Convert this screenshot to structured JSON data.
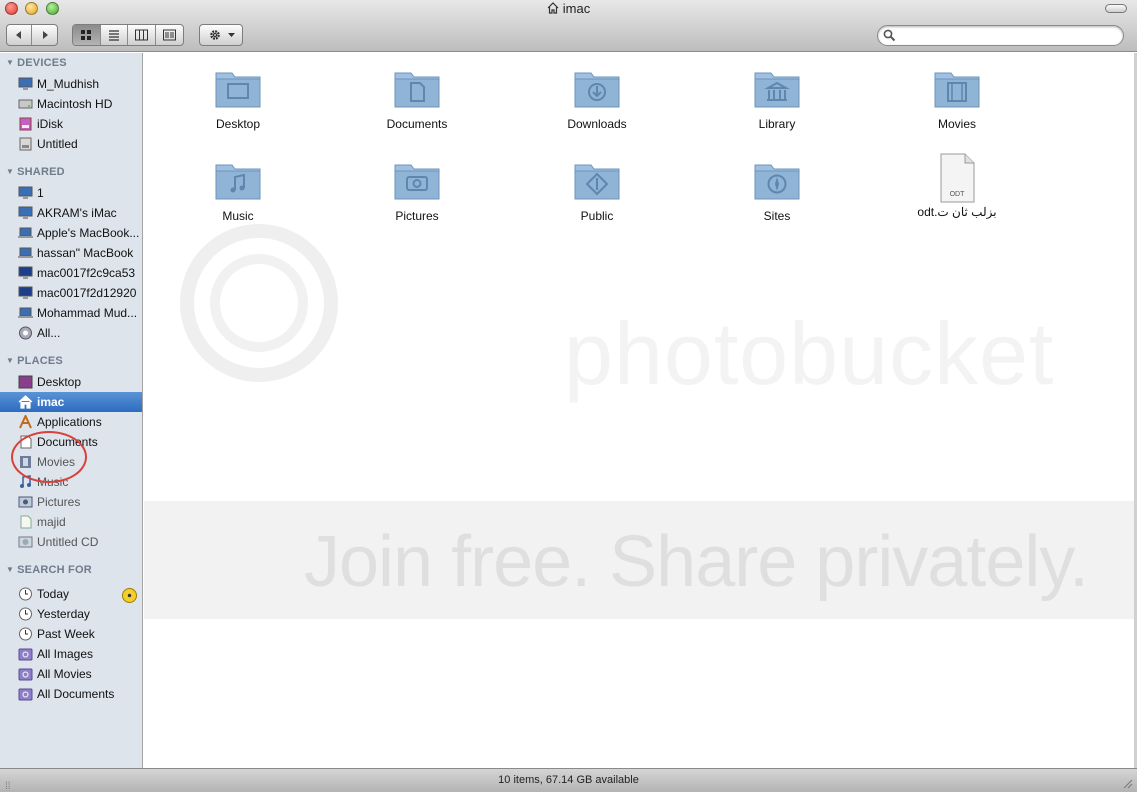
{
  "window": {
    "title": "imac"
  },
  "toolbar": {
    "back_icon": "back-arrow-icon",
    "forward_icon": "forward-arrow-icon",
    "views": [
      "icon-view",
      "list-view",
      "column-view",
      "coverflow-view"
    ],
    "search_placeholder": ""
  },
  "sidebar": {
    "devices": {
      "title": "DEVICES",
      "items": [
        {
          "label": "M_Mudhish",
          "icon": "computer-icon"
        },
        {
          "label": "Macintosh HD",
          "icon": "harddisk-icon"
        },
        {
          "label": "iDisk",
          "icon": "idisk-icon"
        },
        {
          "label": "Untitled",
          "icon": "disk-icon"
        }
      ]
    },
    "shared": {
      "title": "SHARED",
      "items": [
        {
          "label": "1",
          "icon": "computer-icon"
        },
        {
          "label": "AKRAM's iMac",
          "icon": "computer-icon"
        },
        {
          "label": "Apple's MacBook...",
          "icon": "laptop-icon"
        },
        {
          "label": "hassan\" MacBook",
          "icon": "laptop-icon"
        },
        {
          "label": "mac0017f2c9ca53",
          "icon": "computer-icon"
        },
        {
          "label": "mac0017f2d12920",
          "icon": "computer-icon"
        },
        {
          "label": "Mohammad Mud...",
          "icon": "laptop-icon"
        },
        {
          "label": "All...",
          "icon": "network-icon"
        }
      ]
    },
    "places": {
      "title": "PLACES",
      "items": [
        {
          "label": "Desktop",
          "icon": "desktop-icon"
        },
        {
          "label": "imac",
          "icon": "home-icon"
        },
        {
          "label": "Applications",
          "icon": "applications-icon"
        },
        {
          "label": "Documents",
          "icon": "document-icon"
        },
        {
          "label": "Movies",
          "icon": "film-icon"
        },
        {
          "label": "Music",
          "icon": "music-note-icon"
        },
        {
          "label": "Pictures",
          "icon": "pictures-icon"
        },
        {
          "label": "majid",
          "icon": "file-icon"
        },
        {
          "label": "Untitled CD",
          "icon": "cd-icon"
        }
      ]
    },
    "search_for": {
      "title": "SEARCH FOR",
      "items": [
        {
          "label": "Today",
          "icon": "clock-icon"
        },
        {
          "label": "Yesterday",
          "icon": "clock-icon"
        },
        {
          "label": "Past Week",
          "icon": "clock-icon"
        },
        {
          "label": "All Images",
          "icon": "smart-folder-icon"
        },
        {
          "label": "All Movies",
          "icon": "smart-folder-icon"
        },
        {
          "label": "All Documents",
          "icon": "smart-folder-icon"
        }
      ]
    }
  },
  "content": {
    "items": [
      {
        "label": "Desktop",
        "icon": "desktop-folder-icon"
      },
      {
        "label": "Documents",
        "icon": "documents-folder-icon"
      },
      {
        "label": "Downloads",
        "icon": "downloads-folder-icon"
      },
      {
        "label": "Library",
        "icon": "library-folder-icon"
      },
      {
        "label": "Movies",
        "icon": "movies-folder-icon"
      },
      {
        "label": "Music",
        "icon": "music-folder-icon"
      },
      {
        "label": "Pictures",
        "icon": "pictures-folder-icon"
      },
      {
        "label": "Public",
        "icon": "public-folder-icon"
      },
      {
        "label": "Sites",
        "icon": "sites-folder-icon"
      },
      {
        "label": "odt.بزلب ثان ت",
        "icon": "odt-document-icon",
        "badge": "ODT"
      }
    ]
  },
  "watermark": {
    "brand": "photobucket",
    "tagline": "Join free. Share privately."
  },
  "status": {
    "text": "10 items, 67.14 GB available"
  },
  "colors": {
    "sidebar_bg": "#dde4ec",
    "selection": "#2d6bc0",
    "folder": "#8fb4d6",
    "annotation": "#d8413a"
  }
}
